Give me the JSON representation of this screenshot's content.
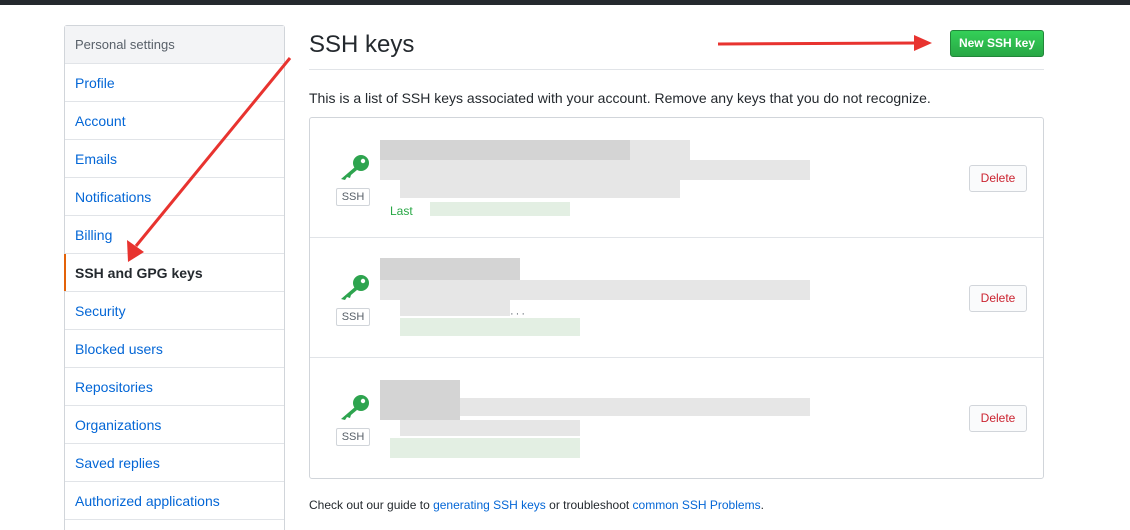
{
  "sidebar": {
    "header": "Personal settings",
    "items": [
      {
        "label": "Profile",
        "selected": false
      },
      {
        "label": "Account",
        "selected": false
      },
      {
        "label": "Emails",
        "selected": false
      },
      {
        "label": "Notifications",
        "selected": false
      },
      {
        "label": "Billing",
        "selected": false
      },
      {
        "label": "SSH and GPG keys",
        "selected": true
      },
      {
        "label": "Security",
        "selected": false
      },
      {
        "label": "Blocked users",
        "selected": false
      },
      {
        "label": "Repositories",
        "selected": false
      },
      {
        "label": "Organizations",
        "selected": false
      },
      {
        "label": "Saved replies",
        "selected": false
      },
      {
        "label": "Authorized applications",
        "selected": false
      }
    ]
  },
  "main": {
    "title": "SSH keys",
    "new_key_button": "New SSH key",
    "intro": "This is a list of SSH keys associated with your account. Remove any keys that you do not recognize.",
    "keys": [
      {
        "type_label": "SSH",
        "last_used_fragment": "Last",
        "delete_label": "Delete"
      },
      {
        "type_label": "SSH",
        "delete_label": "Delete"
      },
      {
        "type_label": "SSH",
        "delete_label": "Delete"
      }
    ],
    "footer": {
      "prefix": "Check out our guide to ",
      "link1": "generating SSH keys",
      "middle": " or troubleshoot ",
      "link2": "common SSH Problems",
      "suffix": "."
    }
  },
  "colors": {
    "accent_green": "#2ea44f",
    "link_blue": "#0366d6",
    "delete_red": "#cb2431",
    "selected_marker": "#e36209",
    "annotation_red": "#e8332f"
  }
}
